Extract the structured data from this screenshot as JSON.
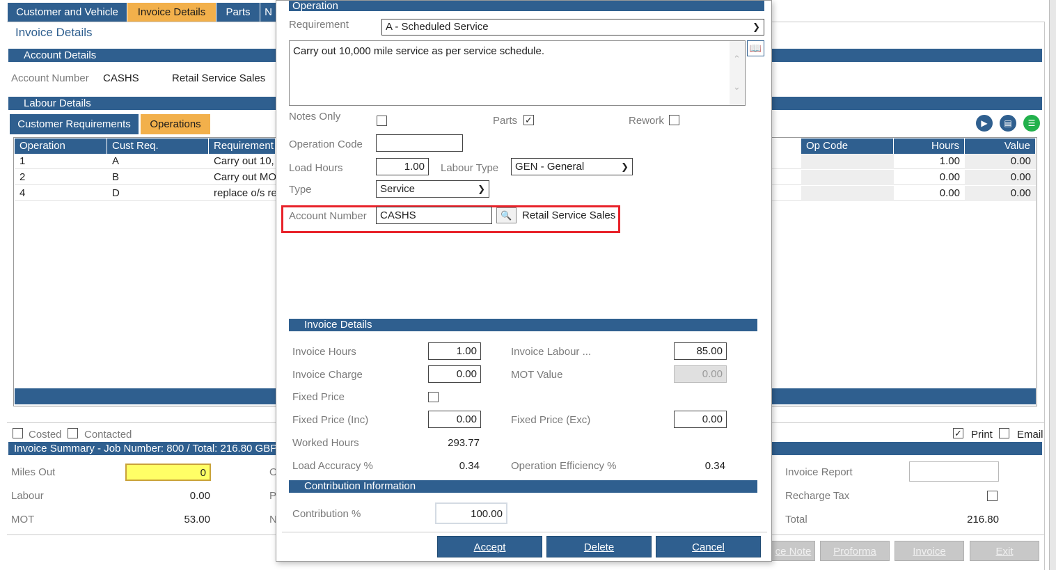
{
  "tabs": [
    "Customer and Vehicle",
    "Invoice Details",
    "Parts",
    "N"
  ],
  "page": {
    "title": "Invoice Details"
  },
  "account_details": {
    "header": "Account Details",
    "label": "Account Number",
    "number": "CASHS",
    "name": "Retail Service Sales"
  },
  "labour_details": {
    "header": "Labour Details",
    "subtabs": [
      "Customer Requirements",
      "Operations"
    ],
    "columns": [
      "Operation",
      "Cust Req.",
      "Requirement",
      "Op Code",
      "Hours",
      "Value"
    ],
    "rows": [
      {
        "operation": "1",
        "cust_req": "A",
        "requirement": "Carry out 10,",
        "hours": "1.00",
        "value": "0.00"
      },
      {
        "operation": "2",
        "cust_req": "B",
        "requirement": "Carry out MO",
        "hours": "0.00",
        "value": "0.00"
      },
      {
        "operation": "4",
        "cust_req": "D",
        "requirement": "replace o/s re",
        "hours": "0.00",
        "value": "0.00"
      }
    ]
  },
  "flags": {
    "costed": "Costed",
    "contacted": "Contacted",
    "print": "Print",
    "email": "Email"
  },
  "invoice_summary": {
    "header": "Invoice Summary - Job Number: 800 / Total: 216.80 GBP",
    "miles_out_label": "Miles Out",
    "miles_out": "0",
    "labour_label": "Labour",
    "labour": "0.00",
    "mot_label": "MOT",
    "mot": "53.00",
    "col2_letters": [
      "O",
      "P",
      "N"
    ],
    "invoice_report_label": "Invoice Report",
    "recharge_tax_label": "Recharge Tax",
    "total_label": "Total",
    "total": "216.80"
  },
  "bottom_buttons": [
    "ce Note",
    "Proforma",
    "Invoice",
    "Exit"
  ],
  "dialog": {
    "title": "Operation",
    "requirement_label": "Requirement",
    "requirement": "A - Scheduled Service",
    "notes": "Carry out 10,000 mile service as per service schedule.",
    "notes_only_label": "Notes Only",
    "parts_label": "Parts",
    "rework_label": "Rework",
    "op_code_label": "Operation Code",
    "op_code": "",
    "load_hours_label": "Load Hours",
    "load_hours": "1.00",
    "labour_type_label": "Labour Type",
    "labour_type": "GEN - General",
    "type_label": "Type",
    "type": "Service",
    "account_label": "Account Number",
    "account": "CASHS",
    "account_name": "Retail Service Sales",
    "invoice_details_header": "Invoice Details",
    "invoice_hours_label": "Invoice Hours",
    "invoice_hours": "1.00",
    "invoice_labour_label": "Invoice Labour ...",
    "invoice_labour": "85.00",
    "invoice_charge_label": "Invoice Charge",
    "invoice_charge": "0.00",
    "mot_value_label": "MOT Value",
    "mot_value": "0.00",
    "fixed_price_label": "Fixed Price",
    "fixed_inc_label": "Fixed Price (Inc)",
    "fixed_inc": "0.00",
    "fixed_exc_label": "Fixed Price (Exc)",
    "fixed_exc": "0.00",
    "worked_hours_label": "Worked Hours",
    "worked_hours": "293.77",
    "load_accuracy_label": "Load Accuracy %",
    "load_accuracy": "0.34",
    "op_efficiency_label": "Operation Efficiency %",
    "op_efficiency": "0.34",
    "contribution_header": "Contribution Information",
    "contribution_label": "Contribution %",
    "contribution": "100.00",
    "buttons": {
      "accept": "Accept",
      "delete": "Delete",
      "cancel": "Cancel"
    }
  },
  "colors": {
    "navy": "#2f5f8f",
    "active_tab": "#f2b04b",
    "highlight": "#e8222a",
    "miles_field": "#ffff66"
  },
  "icons": [
    "video-icon",
    "document-icon",
    "chat-icon",
    "book-icon",
    "search-icon",
    "check-icon",
    "chevron-down-icon"
  ]
}
